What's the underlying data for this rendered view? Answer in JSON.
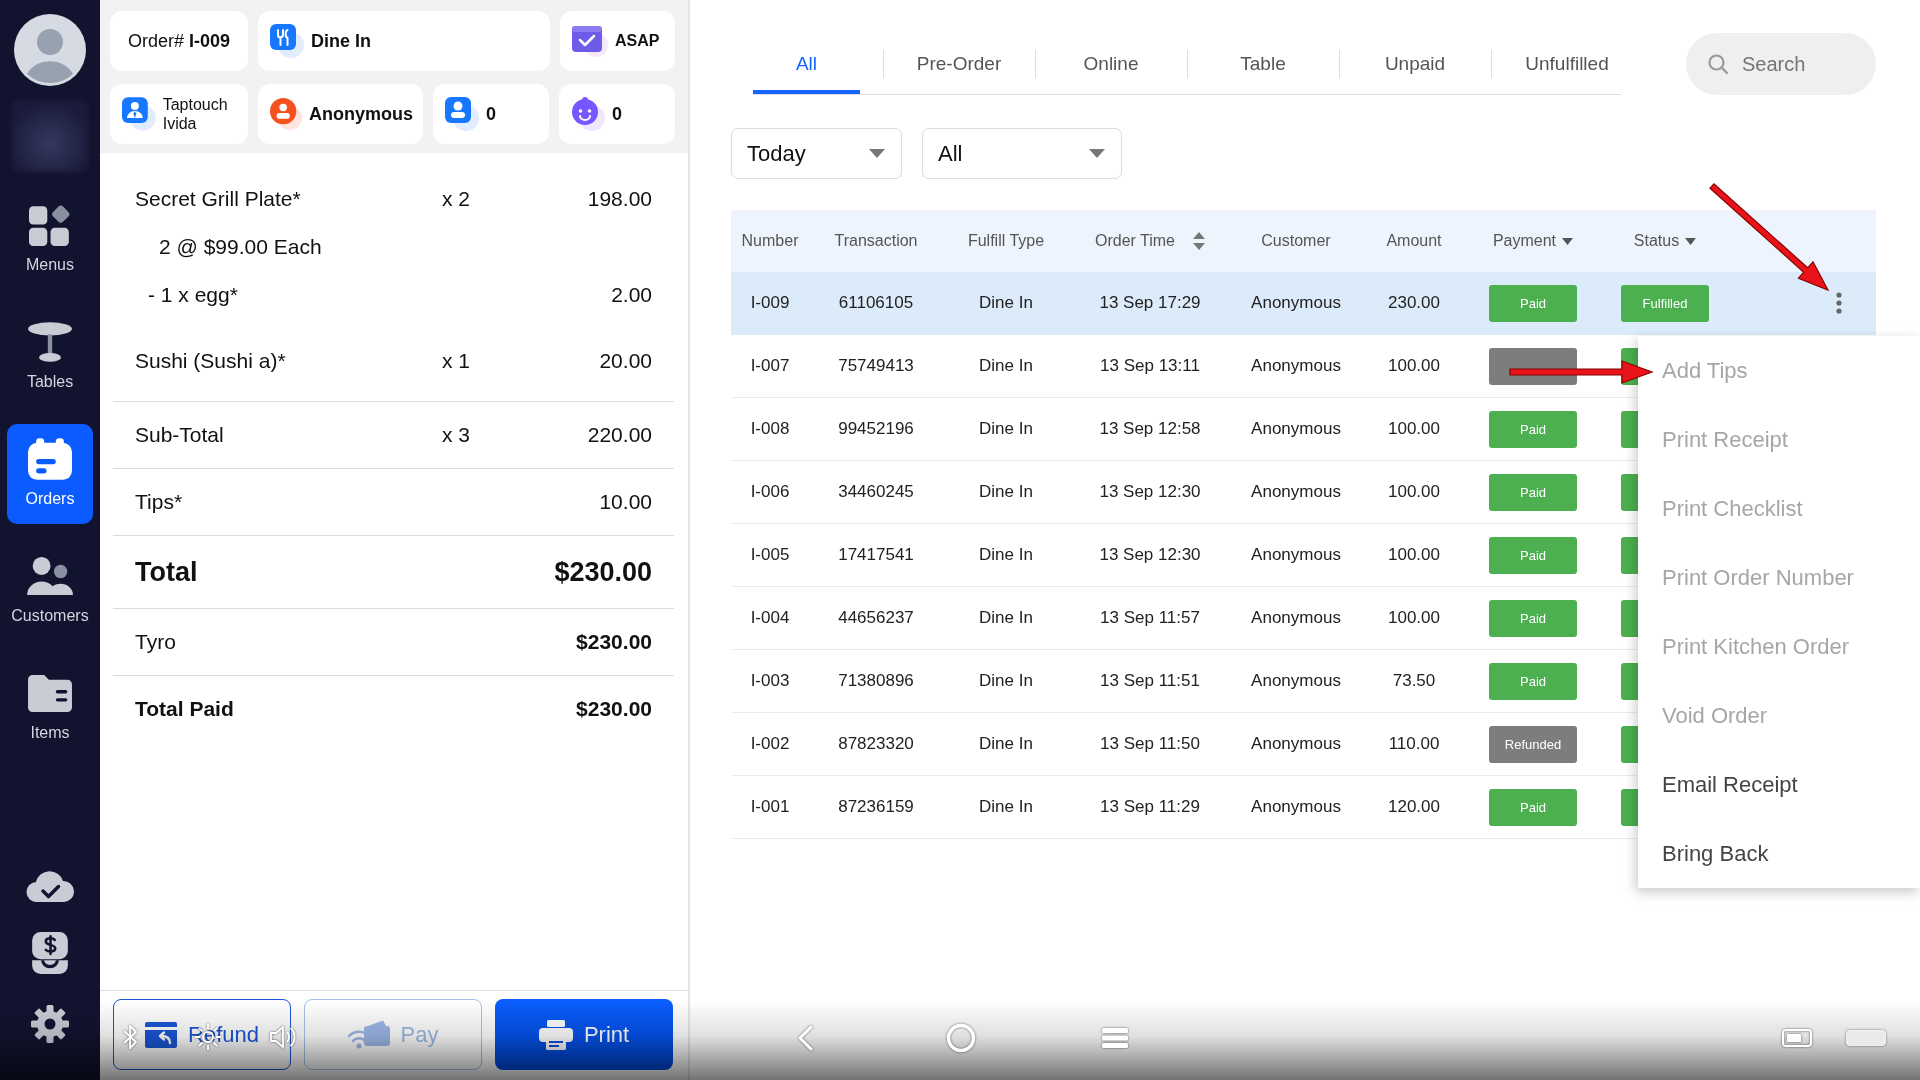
{
  "sidebar": {
    "items": [
      {
        "label": "Menus",
        "selected": false
      },
      {
        "label": "Tables",
        "selected": false
      },
      {
        "label": "Orders",
        "selected": true
      },
      {
        "label": "Customers",
        "selected": false
      },
      {
        "label": "Items",
        "selected": false
      }
    ]
  },
  "order": {
    "header": {
      "order_number": "Order# **I-009**",
      "fulfill_type": "Dine In",
      "timing": "ASAP",
      "staff": "Taptouch Ivida",
      "customer": "Anonymous",
      "guests": "0",
      "kids": "0"
    },
    "lines": [
      {
        "kind": "item",
        "name": "Secret Grill Plate*",
        "qty": "x 2",
        "amount": "198.00"
      },
      {
        "kind": "detail",
        "name": "2 @ $99.00 Each"
      },
      {
        "kind": "modifier",
        "name": "- 1 x egg*",
        "amount": "2.00"
      },
      {
        "kind": "item",
        "name": "Sushi (Sushi a)*",
        "qty": "x 1",
        "amount": "20.00"
      }
    ],
    "summary": [
      {
        "kind": "subtotal",
        "label": "Sub-Total",
        "qty": "x 3",
        "amount": "220.00"
      },
      {
        "kind": "tips",
        "label": "Tips*",
        "amount": "10.00"
      },
      {
        "kind": "total",
        "label": "Total",
        "amount": "$230.00"
      },
      {
        "kind": "payment",
        "label": "Tyro",
        "amount": "$230.00"
      },
      {
        "kind": "paid",
        "label": "Total Paid",
        "amount": "$230.00"
      }
    ],
    "buttons": [
      {
        "label": "Refund",
        "kind": "outline",
        "disabled": false
      },
      {
        "label": "Pay",
        "kind": "outline",
        "disabled": true
      },
      {
        "label": "Print",
        "kind": "primary",
        "disabled": false
      }
    ]
  },
  "orders": {
    "tabs": [
      {
        "label": "All",
        "selected": true
      },
      {
        "label": "Pre-Order",
        "selected": false
      },
      {
        "label": "Online",
        "selected": false
      },
      {
        "label": "Table",
        "selected": false
      },
      {
        "label": "Unpaid",
        "selected": false
      },
      {
        "label": "Unfulfilled",
        "selected": false
      }
    ],
    "search": {
      "placeholder": "Search"
    },
    "filters": [
      {
        "value": "Today"
      },
      {
        "value": "All"
      }
    ],
    "table": {
      "columns": [
        {
          "label": "Number",
          "kind": "plain"
        },
        {
          "label": "Transaction",
          "kind": "plain"
        },
        {
          "label": "Fulfill Type",
          "kind": "plain"
        },
        {
          "label": "Order Time",
          "kind": "sortable"
        },
        {
          "label": "Customer",
          "kind": "plain"
        },
        {
          "label": "Amount",
          "kind": "plain"
        },
        {
          "label": "Payment",
          "kind": "filter"
        },
        {
          "label": "Status",
          "kind": "filter"
        }
      ],
      "rows": [
        {
          "number": "I-009",
          "transaction": "61106105",
          "fulfill_type": "Dine In",
          "order_time": "13 Sep 17:29",
          "customer": "Anonymous",
          "amount": "230.00",
          "payment": {
            "label": "Paid",
            "kind": "paid"
          },
          "status": {
            "label": "Fulfilled",
            "kind": "fulfilled",
            "covered": false
          },
          "selected": true
        },
        {
          "number": "I-007",
          "transaction": "75749413",
          "fulfill_type": "Dine In",
          "order_time": "13 Sep 13:11",
          "customer": "Anonymous",
          "amount": "100.00",
          "payment": {
            "kind": "refunded"
          },
          "status": {
            "kind": "fulfilled",
            "covered": true
          },
          "selected": false
        },
        {
          "number": "I-008",
          "transaction": "99452196",
          "fulfill_type": "Dine In",
          "order_time": "13 Sep 12:58",
          "customer": "Anonymous",
          "amount": "100.00",
          "payment": {
            "label": "Paid",
            "kind": "paid"
          },
          "status": {
            "kind": "fulfilled",
            "covered": true
          },
          "selected": false
        },
        {
          "number": "I-006",
          "transaction": "34460245",
          "fulfill_type": "Dine In",
          "order_time": "13 Sep 12:30",
          "customer": "Anonymous",
          "amount": "100.00",
          "payment": {
            "label": "Paid",
            "kind": "paid"
          },
          "status": {
            "kind": "fulfilled",
            "covered": true
          },
          "selected": false
        },
        {
          "number": "I-005",
          "transaction": "17417541",
          "fulfill_type": "Dine In",
          "order_time": "13 Sep 12:30",
          "customer": "Anonymous",
          "amount": "100.00",
          "payment": {
            "label": "Paid",
            "kind": "paid"
          },
          "status": {
            "kind": "fulfilled",
            "covered": true
          },
          "selected": false
        },
        {
          "number": "I-004",
          "transaction": "44656237",
          "fulfill_type": "Dine In",
          "order_time": "13 Sep 11:57",
          "customer": "Anonymous",
          "amount": "100.00",
          "payment": {
            "label": "Paid",
            "kind": "paid"
          },
          "status": {
            "kind": "fulfilled",
            "covered": true
          },
          "selected": false
        },
        {
          "number": "I-003",
          "transaction": "71380896",
          "fulfill_type": "Dine In",
          "order_time": "13 Sep 11:51",
          "customer": "Anonymous",
          "amount": "73.50",
          "payment": {
            "label": "Paid",
            "kind": "paid"
          },
          "status": {
            "kind": "fulfilled",
            "covered": true
          },
          "selected": false
        },
        {
          "number": "I-002",
          "transaction": "87823320",
          "fulfill_type": "Dine In",
          "order_time": "13 Sep 11:50",
          "customer": "Anonymous",
          "amount": "110.00",
          "payment": {
            "label": "Refunded",
            "kind": "refunded"
          },
          "status": {
            "kind": "fulfilled",
            "covered": true
          },
          "selected": false
        },
        {
          "number": "I-001",
          "transaction": "87236159",
          "fulfill_type": "Dine In",
          "order_time": "13 Sep 11:29",
          "customer": "Anonymous",
          "amount": "120.00",
          "payment": {
            "label": "Paid",
            "kind": "paid"
          },
          "status": {
            "kind": "fulfilled",
            "covered": true
          },
          "selected": false
        }
      ]
    },
    "row_menu": {
      "items": [
        {
          "label": "Add Tips",
          "disabled": true
        },
        {
          "label": "Print Receipt",
          "disabled": true
        },
        {
          "label": "Print Checklist",
          "disabled": true
        },
        {
          "label": "Print Order Number",
          "disabled": true
        },
        {
          "label": "Print Kitchen Order",
          "disabled": true
        },
        {
          "label": "Void Order",
          "disabled": true
        },
        {
          "label": "Email Receipt",
          "disabled": false
        },
        {
          "label": "Bring Back",
          "disabled": false
        }
      ]
    }
  }
}
